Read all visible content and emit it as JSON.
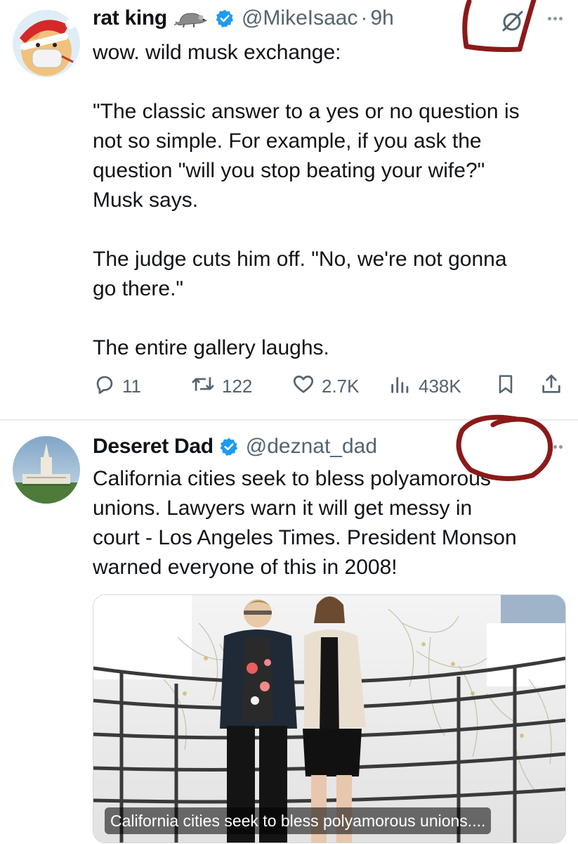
{
  "tweets": [
    {
      "display_name": "rat king",
      "emoji_icon": "rat-emoji",
      "verified": true,
      "handle": "@MikeIsaac",
      "separator": "·",
      "time": "9h",
      "text_lines": [
        "wow. wild musk exchange:",
        "",
        "\"The classic answer to a yes or no question is",
        "not so simple. For example, if you ask the",
        "question \"will you stop beating your wife?\"",
        "Musk says.",
        "",
        "The judge cuts him off. \"No, we're not gonna",
        "go there.\"",
        "",
        "The entire gallery laughs."
      ],
      "actions": {
        "replies": "11",
        "reposts": "122",
        "likes": "2.7K",
        "views": "438K"
      }
    },
    {
      "display_name": "Deseret Dad",
      "verified": true,
      "handle": "@deznat_dad",
      "text_lines": [
        "California cities seek to bless polyamorous",
        "unions. Lawyers warn it will get messy in",
        "court - Los Angeles Times. President Monson",
        "warned everyone of this in 2008!"
      ],
      "link_card": {
        "caption": "California cities seek to bless polyamorous unions...."
      }
    }
  ],
  "colors": {
    "text_primary": "#0f1419",
    "text_secondary": "#536471",
    "verified_blue": "#1d9bf0",
    "annotation_red": "#8b1a1a",
    "divider": "#e7e9ea"
  },
  "icons": [
    "reply-icon",
    "repost-icon",
    "like-icon",
    "views-icon",
    "bookmark-icon",
    "share-icon",
    "grok-icon",
    "more-icon",
    "verified-badge-icon"
  ]
}
